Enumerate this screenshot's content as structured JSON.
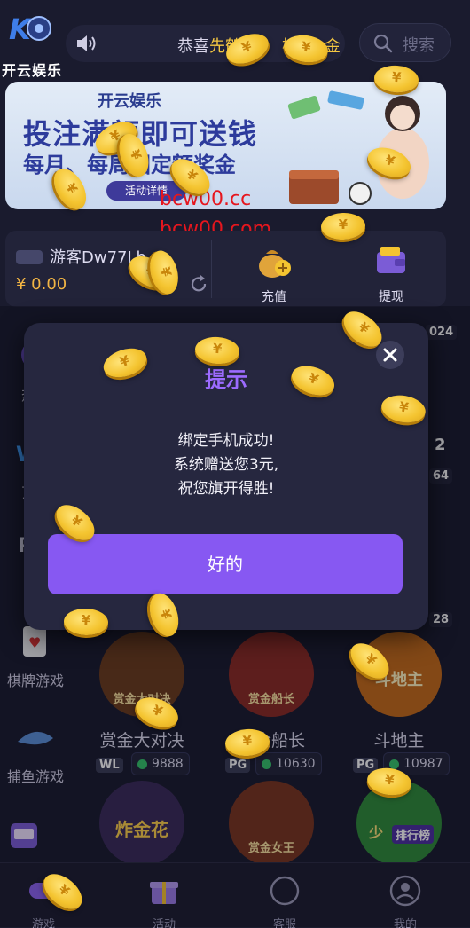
{
  "header": {
    "brand": "开云娱乐",
    "marquee_prefix": "恭喜",
    "marquee_highlight": "先鹤",
    "marquee_suffix": "榛",
    "marquee_tail": "金",
    "search_placeholder": "搜索"
  },
  "banner": {
    "brand": "开云娱乐",
    "line1": "投注满额即可送钱",
    "line2": "每月、每周固定额奖金",
    "button": "活动详情"
  },
  "watermark": [
    "bcw00.cc",
    "bcw00.com"
  ],
  "wallet": {
    "username": "游客Dw77Lb",
    "balance": "¥ 0.00",
    "recharge": "充值",
    "withdraw": "提现"
  },
  "categories": [
    "热门",
    "瓦力",
    "PG",
    "棋牌游戏",
    "捕鱼游戏"
  ],
  "partial_counts": [
    "024",
    "2",
    "64",
    "28"
  ],
  "games_row1": [
    {
      "name": "赏金大对决",
      "art_text": "赏金大对决"
    },
    {
      "name": "赏金船长",
      "art_text": "赏金船长"
    },
    {
      "name": "斗地主",
      "art_text": "斗地主"
    }
  ],
  "games_row2": [
    {
      "provider": "WL",
      "count": "9888",
      "art_text": "炸金花"
    },
    {
      "provider": "PG",
      "count": "10630",
      "art_text": "赏金女王"
    },
    {
      "provider": "PG",
      "count": "10987",
      "art_text": "少",
      "tag": "排行榜"
    }
  ],
  "dialog": {
    "title": "提示",
    "line1": "绑定手机成功!",
    "line2": "系统赠送您3元,",
    "line3": "祝您旗开得胜!",
    "ok": "好的"
  },
  "nav": [
    {
      "label": "游戏",
      "icon": "gamepad-icon"
    },
    {
      "label": "活动",
      "icon": "gift-icon"
    },
    {
      "label": "客服",
      "icon": "support-icon"
    },
    {
      "label": "我的",
      "icon": "user-icon"
    }
  ],
  "colors": {
    "background": "#1a1b2e",
    "accent_purple": "#8758f2",
    "title_purple": "#9c6bff",
    "gold": "#f4c430",
    "watermark_red": "#e6161e"
  }
}
